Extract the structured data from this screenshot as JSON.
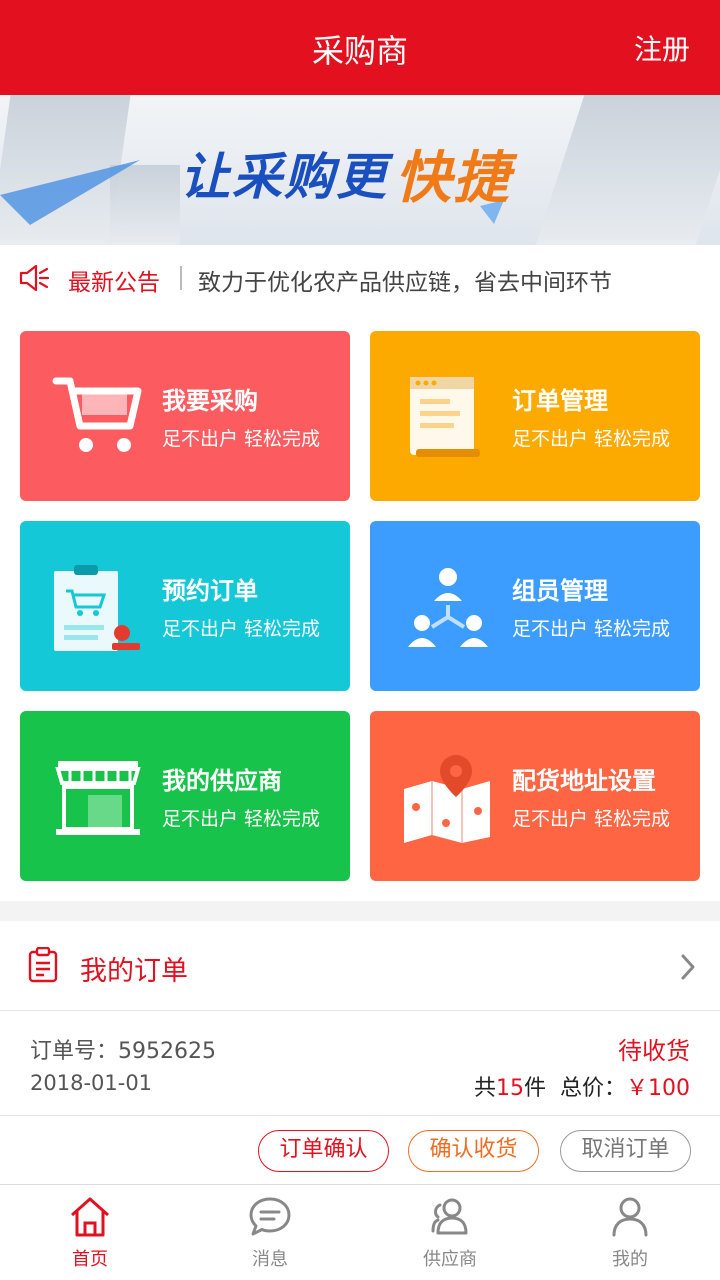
{
  "header": {
    "title": "采购商",
    "register": "注册"
  },
  "banner": {
    "slogan_main": "让采购更",
    "slogan_accent": "快捷"
  },
  "notice": {
    "label": "最新公告",
    "text": "致力于优化农产品供应链，省去中间环节"
  },
  "cards": [
    {
      "title": "我要采购",
      "subtitle": "足不出户 轻松完成",
      "color": "#fc5b5f",
      "icon": "cart-icon"
    },
    {
      "title": "订单管理",
      "subtitle": "足不出户 轻松完成",
      "color": "#fdaa00",
      "icon": "document-icon"
    },
    {
      "title": "预约订单",
      "subtitle": "足不出户 轻松完成",
      "color": "#14c8d8",
      "icon": "clipboard-stamp-icon"
    },
    {
      "title": "组员管理",
      "subtitle": "足不出户 轻松完成",
      "color": "#3c9dff",
      "icon": "team-icon"
    },
    {
      "title": "我的供应商",
      "subtitle": "足不出户 轻松完成",
      "color": "#17c34a",
      "icon": "store-icon"
    },
    {
      "title": "配货地址设置",
      "subtitle": "足不出户 轻松完成",
      "color": "#fd6543",
      "icon": "map-pin-icon"
    }
  ],
  "orders": {
    "title": "我的订单",
    "item": {
      "number_label": "订单号：",
      "number": "5952625",
      "date": "2018-01-01",
      "status": "待收货",
      "count_prefix": "共",
      "count": "15",
      "count_suffix": "件",
      "price_label": "总价：",
      "price": "￥100"
    },
    "actions": {
      "confirm": "订单确认",
      "receive": "确认收货",
      "cancel": "取消订单"
    }
  },
  "tabs": [
    {
      "label": "首页",
      "icon": "home-icon",
      "active": true
    },
    {
      "label": "消息",
      "icon": "message-icon",
      "active": false
    },
    {
      "label": "供应商",
      "icon": "supplier-icon",
      "active": false
    },
    {
      "label": "我的",
      "icon": "user-icon",
      "active": false
    }
  ],
  "colors": {
    "brand_red": "#e3111f",
    "accent_orange": "#f06d22"
  }
}
